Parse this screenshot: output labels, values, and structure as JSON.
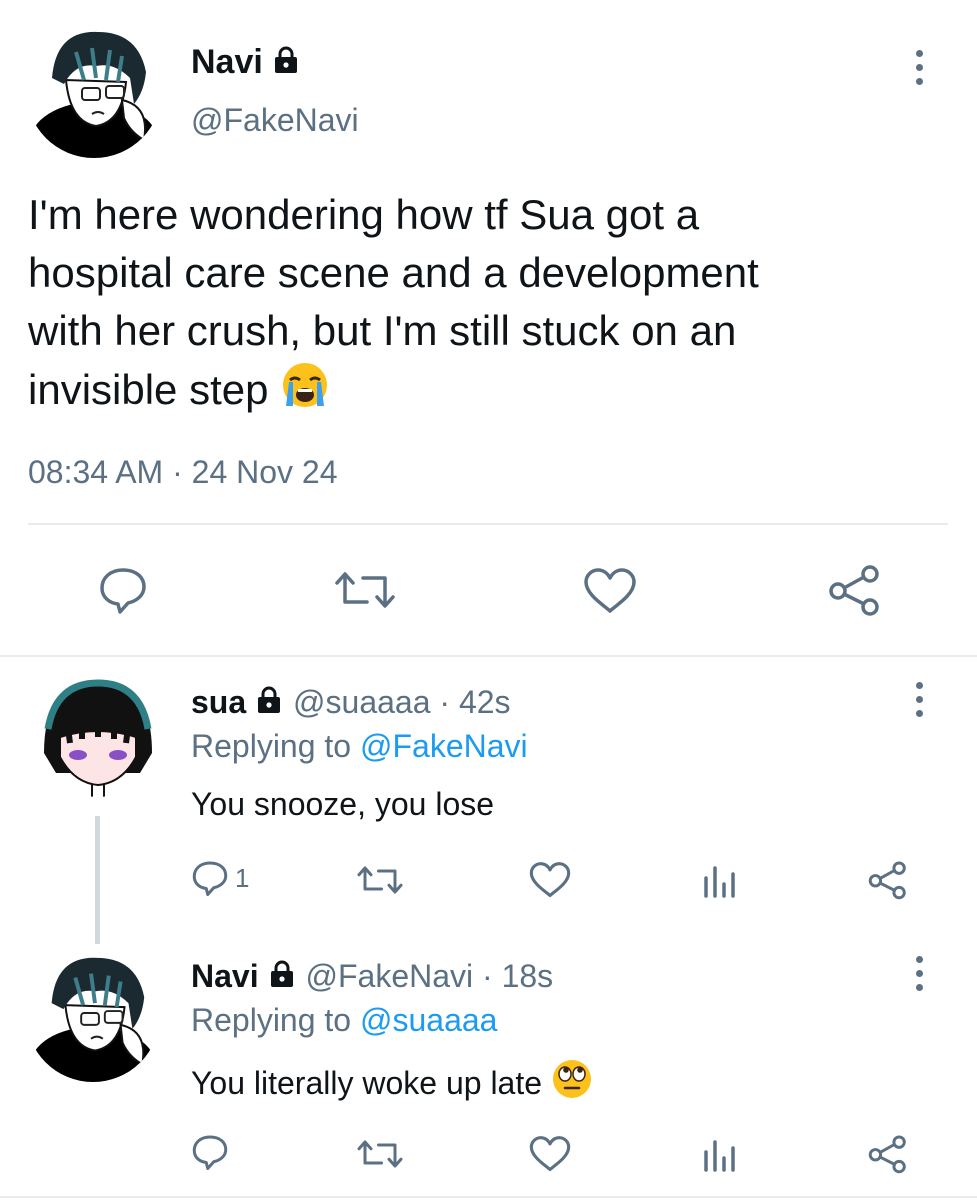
{
  "main_tweet": {
    "display_name": "Navi",
    "handle": "@FakeNavi",
    "text": "I'm here wondering how tf Sua got a hospital care scene and a development with her crush, but I'm still stuck on an invisible step",
    "text_lines": [
      "I'm here wondering how tf Sua got a",
      "hospital care scene and a development",
      "with her crush, but I'm still stuck on an",
      "invisible step"
    ],
    "emoji": "loudly-crying-face",
    "time": "08:34 AM",
    "separator": "·",
    "date": "24 Nov 24"
  },
  "replies": [
    {
      "display_name": "sua",
      "handle": "@suaaaa",
      "age": "42s",
      "replying_prefix": "Replying to",
      "replying_to": "@FakeNavi",
      "text": "You snooze, you lose",
      "reply_count": "1"
    },
    {
      "display_name": "Navi",
      "handle": "@FakeNavi",
      "age": "18s",
      "replying_prefix": "Replying to",
      "replying_to": "@suaaaa",
      "text": "You literally woke up late",
      "emoji": "face-with-rolling-eyes"
    }
  ],
  "colors": {
    "text": "#0f1419",
    "muted": "#5b7083",
    "link": "#1d9bf0",
    "divider": "#e6ecf0"
  }
}
